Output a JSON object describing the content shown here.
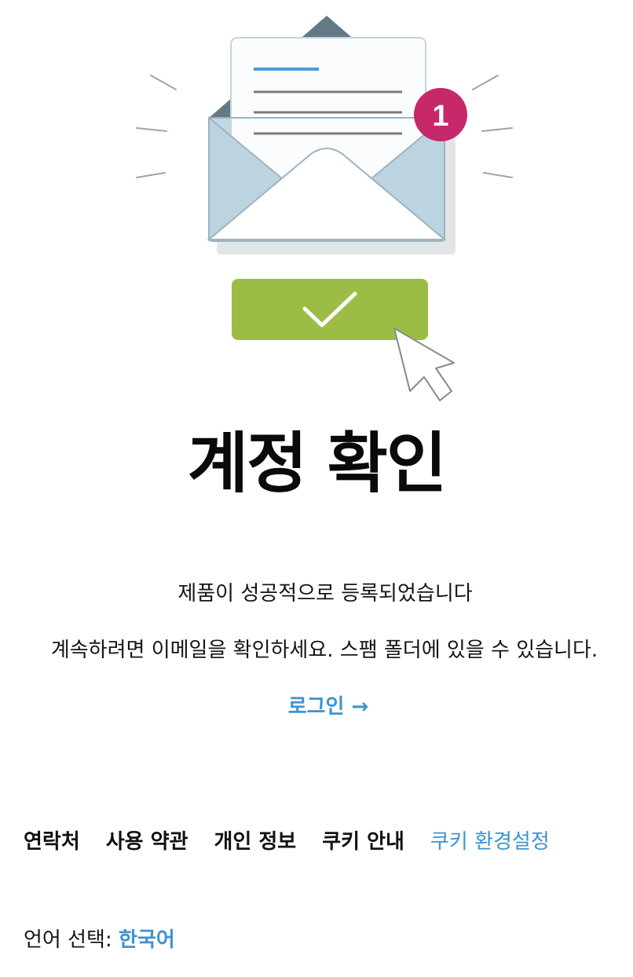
{
  "illustration": {
    "notification_count": "1",
    "colors": {
      "envelope_back": "#637985",
      "envelope_inner": "#c0d7e4",
      "envelope_outline": "#9fb3bf",
      "letter": "#fafcfd",
      "letter_accent_line": "#4a9bd6",
      "letter_text_lines": "#7b7b7b",
      "badge": "#c6286a",
      "confirm_button": "#9cbd45",
      "ray_lines": "#9aa5ab",
      "cursor_outline": "#8a8a8a"
    }
  },
  "page": {
    "title": "계정 확인",
    "message_registered": "제품이 성공적으로 등록되었습니다",
    "message_check_email": "계속하려면 이메일을 확인하세요. 스팸 폴더에 있을 수 있습니다.",
    "login_link": "로그인 →"
  },
  "footer": {
    "links": {
      "contact": "연락처",
      "terms": "사용 약관",
      "privacy": "개인 정보",
      "cookies": "쿠키 안내",
      "cookie_settings": "쿠키 환경설정"
    },
    "language_label": "언어 선택:",
    "language_value": "한국어"
  },
  "colors": {
    "link_accent": "#3d93d0",
    "text": "#111111"
  }
}
